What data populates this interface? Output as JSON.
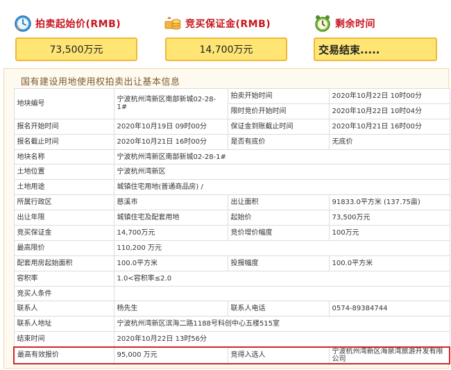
{
  "summary": {
    "start_price": {
      "label": "拍卖起始价(RMB)",
      "value": "73,500万元",
      "icon": "clock-icon"
    },
    "deposit": {
      "label": "竞买保证金(RMB)",
      "value": "14,700万元",
      "icon": "coins-icon"
    },
    "remaining": {
      "label": "剩余时间",
      "value": "交易结束.....",
      "icon": "alarm-clock-icon"
    }
  },
  "section_title": "国有建设用地使用权拍卖出让基本信息",
  "colors": {
    "accent_red": "#c7161e",
    "box_fill": "#ffe574",
    "box_border": "#f3b536"
  },
  "rows": {
    "r1": {
      "k1": "地块编号",
      "v1": "宁波杭州湾新区南部新城02-28-1#",
      "k2a": "拍卖开始时间",
      "v2a": "2020年10月22日 10时00分",
      "k2b": "限时竞价开始时间",
      "v2b": "2020年10月22日 10时04分"
    },
    "r2": {
      "k1": "报名开始时间",
      "v1": "2020年10月19日 09时00分",
      "k2": "保证金到账截止时间",
      "v2": "2020年10月21日 16时00分"
    },
    "r3": {
      "k1": "报名截止时间",
      "v1": "2020年10月21日 16时00分",
      "k2": "是否有底价",
      "v2": "无底价"
    },
    "r4": {
      "k1": "地块名称",
      "v1": "宁波杭州湾新区南部新城02-28-1#"
    },
    "r5": {
      "k1": "土地位置",
      "v1": "宁波杭州湾新区"
    },
    "r6": {
      "k1": "土地用途",
      "v1": "城镇住宅用地(普通商品房) /"
    },
    "r7": {
      "k1": "所属行政区",
      "v1": "慈溪市",
      "k2": "出让面积",
      "v2": "91833.0平方米 (137.75亩)"
    },
    "r8": {
      "k1": "出让年限",
      "v1": "城镇住宅及配套用地",
      "k2": "起始价",
      "v2": "73,500万元"
    },
    "r9": {
      "k1": "竞买保证金",
      "v1": "14,700万元",
      "k2": "竞价增价幅度",
      "v2": "100万元"
    },
    "r10": {
      "k1": "最高限价",
      "v1": "110,200 万元"
    },
    "r11": {
      "k1": "配套用房起始面积",
      "v1": "100.0平方米",
      "k2": "投报幅度",
      "v2": "100.0平方米"
    },
    "r12": {
      "k1": "容积率",
      "v1": "1.0<容积率≤2.0"
    },
    "r13": {
      "k1": "竞买人条件",
      "v1": ""
    },
    "r14": {
      "k1": "联系人",
      "v1": "杨先生",
      "k2": "联系人电话",
      "v2": "0574-89384744"
    },
    "r15": {
      "k1": "联系人地址",
      "v1": "宁波杭州湾新区滨海二路1188号科创中心五楼515室"
    },
    "r16": {
      "k1": "结束时间",
      "v1": "2020年10月22日 13时56分"
    },
    "r17": {
      "k1": "最高有效报价",
      "v1": "95,000 万元",
      "k2": "竞得入选人",
      "v2": "宁波杭州湾新区海泉湾旅游开发有限公司"
    }
  }
}
